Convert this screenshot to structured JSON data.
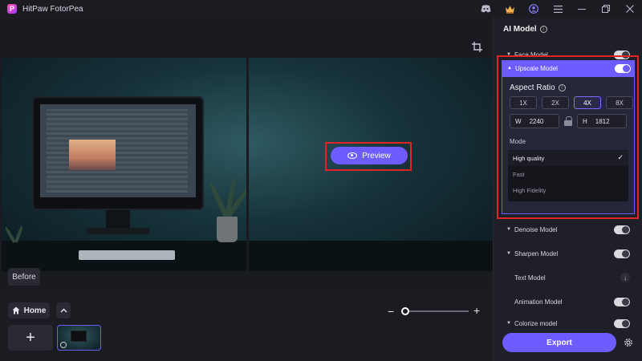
{
  "app": {
    "title": "HitPaw FotorPea",
    "logo_letter": "P"
  },
  "titlebar_icons": [
    "discord-icon",
    "crown-icon",
    "account-icon",
    "menu-icon",
    "minimize-icon",
    "maximize-icon",
    "close-icon"
  ],
  "canvas": {
    "before_label": "Before",
    "preview_label": "Preview"
  },
  "bottom": {
    "home_label": "Home",
    "add_label": "+",
    "zoom_minus": "−",
    "zoom_plus": "+",
    "zoom_level": 0
  },
  "panel": {
    "title": "AI Model",
    "models": [
      {
        "label": "Face Model",
        "toggle": "off"
      },
      {
        "label": "Upscale Model",
        "toggle": "on",
        "expanded": true
      },
      {
        "label": "Denoise Model",
        "toggle": "off"
      },
      {
        "label": "Sharpen Model",
        "toggle": "off"
      },
      {
        "label": "Text Model",
        "control": "download"
      },
      {
        "label": "Animation Model",
        "toggle": "off"
      },
      {
        "label": "Colorize model",
        "toggle": "off"
      }
    ],
    "upscale": {
      "aspect_ratio_label": "Aspect Ratio",
      "scales": [
        "1X",
        "2X",
        "4X",
        "8X"
      ],
      "selected_scale": "4X",
      "width_label": "W",
      "width_value": "2240",
      "height_label": "H",
      "height_value": "1812",
      "mode_label": "Mode",
      "modes": [
        "High quality",
        "Fast",
        "High Fidelity"
      ],
      "selected_mode": "High quality"
    },
    "export_label": "Export"
  },
  "colors": {
    "accent": "#6d5cff",
    "highlight": "#e02525",
    "panel_bg": "#1f1f27"
  }
}
